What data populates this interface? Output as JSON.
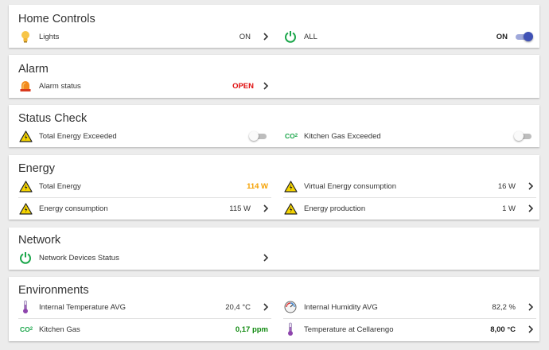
{
  "home_controls": {
    "title": "Home Controls",
    "lights": {
      "label": "Lights",
      "value": "ON"
    },
    "all": {
      "label": "ALL",
      "value": "ON"
    }
  },
  "alarm": {
    "title": "Alarm",
    "status": {
      "label": "Alarm status",
      "value": "OPEN"
    }
  },
  "status_check": {
    "title": "Status Check",
    "energy_exceeded": {
      "label": "Total Energy Exceeded"
    },
    "gas_exceeded": {
      "label": "Kitchen Gas Exceeded",
      "icon_text": "CO",
      "icon_sub": "2"
    }
  },
  "energy": {
    "title": "Energy",
    "total": {
      "label": "Total Energy",
      "value": "114 W"
    },
    "virtual": {
      "label": "Virtual Energy consumption",
      "value": "16 W"
    },
    "consumption": {
      "label": "Energy consumption",
      "value": "115 W"
    },
    "production": {
      "label": "Energy production",
      "value": "1 W"
    }
  },
  "network": {
    "title": "Network",
    "devices": {
      "label": "Network Devices Status"
    }
  },
  "environments": {
    "title": "Environments",
    "temp_avg": {
      "label": "Internal Temperature AVG",
      "value": "20,4 °C"
    },
    "humidity_avg": {
      "label": "Internal Humidity AVG",
      "value": "82,2 %"
    },
    "kitchen_gas": {
      "label": "Kitchen Gas",
      "value": "0,17 ppm",
      "icon_text": "CO",
      "icon_sub": "2"
    },
    "cellarengo": {
      "label": "Temperature at Cellarengo",
      "value": "8,00 °C"
    }
  },
  "colors": {
    "accent_toggle": "#3f51b5",
    "power_green": "#1aa64a",
    "warning_yellow": "#f5d400",
    "open_red": "#e01010",
    "value_orange": "#f5a000",
    "value_green": "#108a10"
  }
}
